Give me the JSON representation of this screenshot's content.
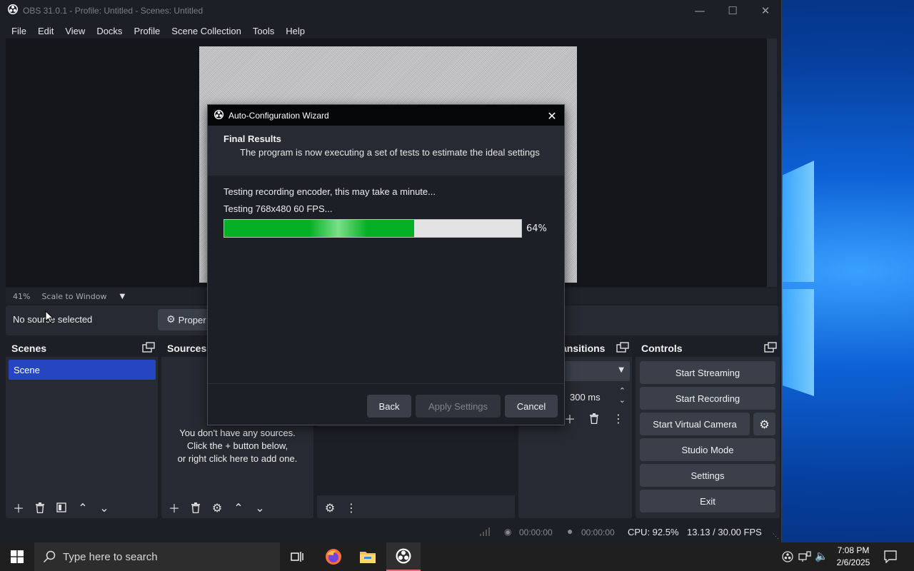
{
  "window": {
    "title": "OBS 31.0.1 - Profile: Untitled - Scenes: Untitled"
  },
  "menu": [
    "File",
    "Edit",
    "View",
    "Docks",
    "Profile",
    "Scene Collection",
    "Tools",
    "Help"
  ],
  "preview": {
    "zoom": "41%",
    "scale_mode": "Scale to Window"
  },
  "source_bar": {
    "status": "No source selected",
    "properties_label": "Proper"
  },
  "docks": {
    "scenes": {
      "title": "Scenes",
      "items": [
        "Scene"
      ]
    },
    "sources": {
      "title": "Sources",
      "empty_text": [
        "You don't have any sources.",
        "Click the + button below,",
        "or right click here to add one."
      ]
    },
    "transitions": {
      "title": "ansitions",
      "duration": "300 ms"
    },
    "controls": {
      "title": "Controls",
      "buttons": [
        "Start Streaming",
        "Start Recording",
        "Start Virtual Camera",
        "Studio Mode",
        "Settings",
        "Exit"
      ]
    }
  },
  "status": {
    "stream_time": "00:00:00",
    "record_time": "00:00:00",
    "cpu": "CPU: 92.5%",
    "fps": "13.13 / 30.00 FPS"
  },
  "dialog": {
    "title": "Auto-Configuration Wizard",
    "heading": "Final Results",
    "subheading": "The program is now executing a set of tests to estimate the ideal settings",
    "line1": "Testing recording encoder, this may take a minute...",
    "line2": "Testing 768x480 60 FPS...",
    "progress": 0.64,
    "progress_label": "64%",
    "buttons": {
      "back": "Back",
      "apply": "Apply Settings",
      "cancel": "Cancel"
    }
  },
  "taskbar": {
    "search_placeholder": "Type here to search",
    "time": "7:08 PM",
    "date": "2/6/2025"
  },
  "colors": {
    "accent": "#2546c0",
    "progress": "#06b025"
  }
}
